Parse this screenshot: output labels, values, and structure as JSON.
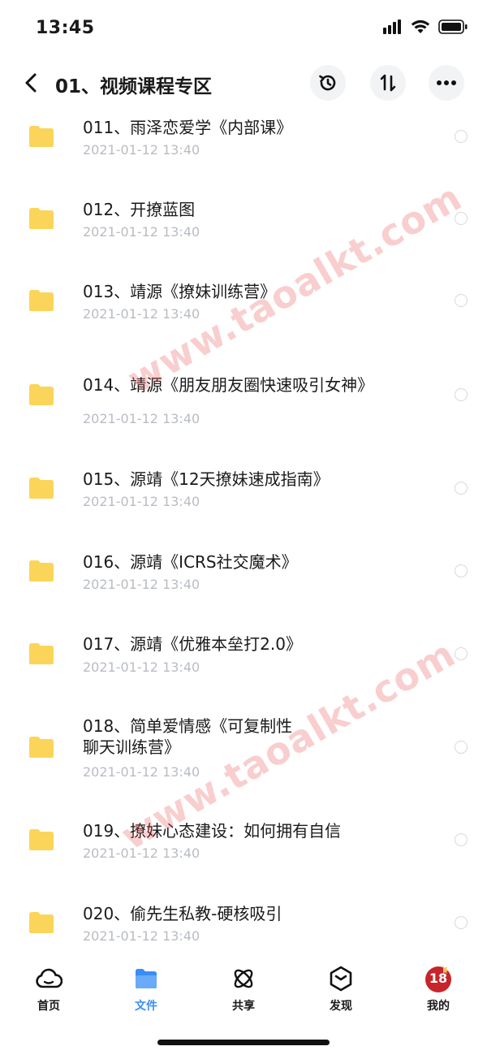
{
  "status_bar": {
    "time": "13:45",
    "icons": [
      "signal-icon",
      "wifi-icon",
      "battery-icon"
    ]
  },
  "nav": {
    "title": "01、视频课程专区",
    "actions": [
      "back-icon",
      "history-icon",
      "sort-icon",
      "more-icon"
    ]
  },
  "files": [
    {
      "name": "011、雨泽恋爱学《内部课》",
      "date": "2021-01-12 13:40"
    },
    {
      "name": "012、开撩蓝图",
      "date": "2021-01-12 13:40"
    },
    {
      "name": "013、靖源《撩妹训练营》",
      "date": "2021-01-12 13:40"
    },
    {
      "name": "014、靖源《朋友朋友圈快速吸引女神》",
      "date": "2021-01-12 13:40"
    },
    {
      "name": "015、源靖《12天撩妹速成指南》",
      "date": "2021-01-12 13:40"
    },
    {
      "name": "016、源靖《ICRS社交魔术》",
      "date": "2021-01-12 13:40"
    },
    {
      "name": "017、源靖《优雅本垒打2.0》",
      "date": "2021-01-12 13:40"
    },
    {
      "name_line1": "018、简单爱情感《可复制性",
      "name_line2": "聊天训练营》",
      "date": "2021-01-12 13:40"
    },
    {
      "name": "019、撩妹心态建设：如何拥有自信",
      "date": "2021-01-12 13:40"
    },
    {
      "name": "020、偷先生私教-硬核吸引",
      "date": "2021-01-12 13:40"
    }
  ],
  "watermark": {
    "text": "www.taoalkt.com",
    "color": "#e85050"
  },
  "tabs": [
    {
      "label": "首页",
      "icon": "cloud-icon"
    },
    {
      "label": "文件",
      "icon": "folder-icon",
      "active": true
    },
    {
      "label": "共享",
      "icon": "atom-icon"
    },
    {
      "label": "发现",
      "icon": "compass-icon"
    },
    {
      "label": "我的",
      "icon": "avatar-icon",
      "avatar_text": "18"
    }
  ],
  "colors": {
    "accent": "#3a8df5",
    "folder": "#fbd55a",
    "date": "#b8bcc4"
  }
}
